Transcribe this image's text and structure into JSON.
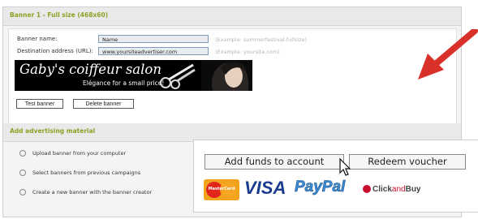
{
  "section1": {
    "title": "Banner 1 - Full size (468x60)",
    "banner_name_label": "Banner name:",
    "banner_name_value": "Name",
    "banner_name_hint": "(Example: summerfestival-fullsize)",
    "destination_label": "Destination address (URL):",
    "destination_value": "www.yoursiteadvertiser.com",
    "destination_hint": "(Example: yoursite.com)",
    "banner_preview": {
      "title": "Gaby's coiffeur salon",
      "subtitle": "Elégance for a small price!"
    },
    "test_button": "Test banner",
    "delete_button": "Delete banner"
  },
  "section2": {
    "title": "Add advertising material",
    "options": [
      "Upload banner from your computer",
      "Select banners from previous campaigns",
      "Create a new banner with the banner creator"
    ]
  },
  "payment_popup": {
    "add_funds_button": "Add funds to account",
    "redeem_button": "Redeem voucher",
    "logos": {
      "mastercard": "MasterCard",
      "visa": "VISA",
      "paypal": "PayPal",
      "clickandbuy_click": "Click",
      "clickandbuy_and": "and",
      "clickandbuy_buy": "Buy"
    }
  },
  "colors": {
    "section_title": "#8aa326",
    "pointer_arrow": "#d9302a",
    "visa_blue": "#1a3b8f",
    "paypal_blue": "#3b8fd6",
    "clickandbuy_red": "#c8102e"
  }
}
